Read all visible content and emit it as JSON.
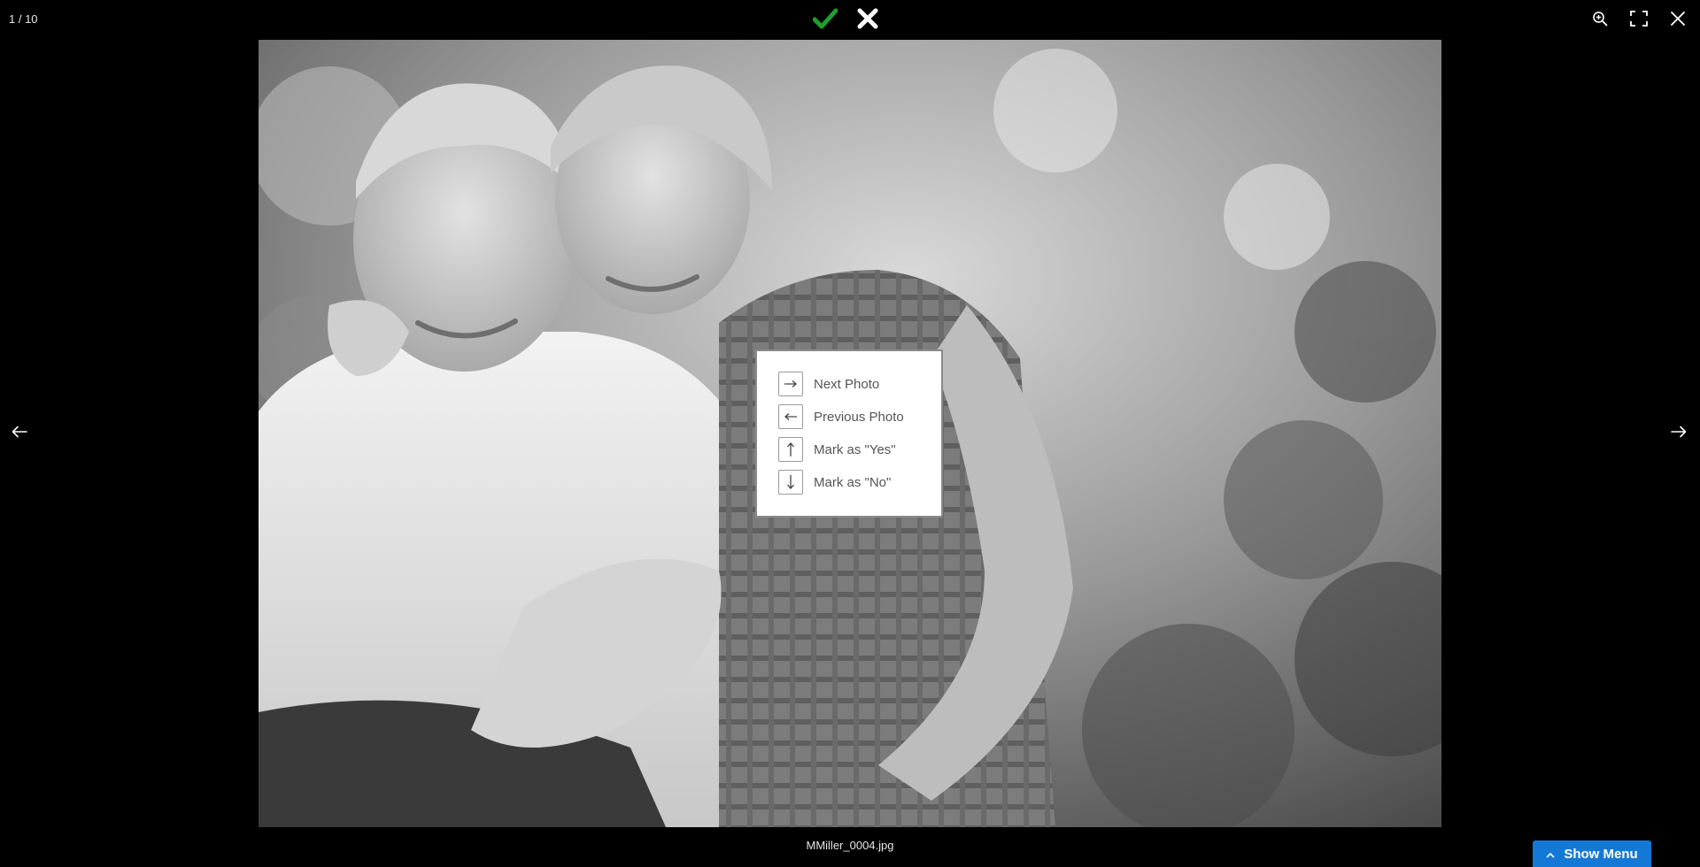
{
  "viewer": {
    "counter": "1 / 10",
    "filename": "MMiller_0004.jpg",
    "accent_color": "#1479d6",
    "approve_color": "#1fa02d"
  },
  "toolbar": {
    "approve_icon": "checkmark-icon",
    "reject_icon": "x-icon",
    "zoom_icon": "zoom-in-icon",
    "fullscreen_icon": "fullscreen-icon",
    "close_icon": "close-icon"
  },
  "navigation": {
    "prev_icon": "arrow-left-icon",
    "next_icon": "arrow-right-icon"
  },
  "shortcuts": {
    "items": [
      {
        "key_icon": "arrow-right-icon",
        "label": "Next Photo"
      },
      {
        "key_icon": "arrow-left-icon",
        "label": "Previous Photo"
      },
      {
        "key_icon": "arrow-up-icon",
        "label": "Mark as \"Yes\""
      },
      {
        "key_icon": "arrow-down-icon",
        "label": "Mark as \"No\""
      }
    ]
  },
  "menu": {
    "show_menu_label": "Show Menu",
    "toggle_icon": "chevron-up-icon"
  }
}
